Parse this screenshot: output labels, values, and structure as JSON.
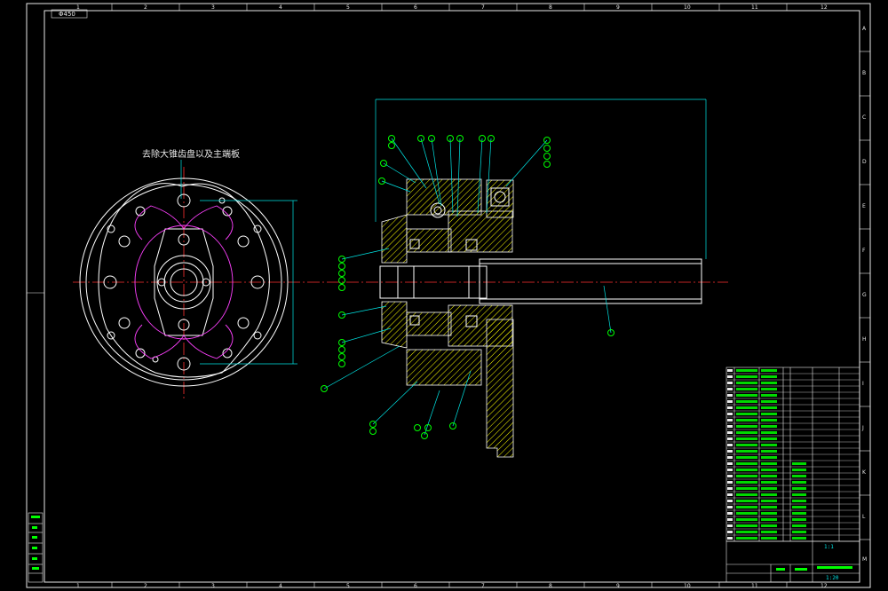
{
  "drawing": {
    "code": "Φ450",
    "annotation": "去除大锥齿盘以及主端板",
    "col_numbers": [
      "1",
      "2",
      "3",
      "4",
      "5",
      "6",
      "7",
      "8",
      "9",
      "10",
      "11",
      "12"
    ],
    "row_letters": [
      "A",
      "B",
      "C",
      "D",
      "E",
      "F",
      "G",
      "H",
      "I",
      "J",
      "K",
      "L",
      "M",
      "N"
    ],
    "colors": {
      "frame": "#e8e8e8",
      "dimension": "#00e6e6",
      "outline": "#ffffff",
      "center_line": "#ff3030",
      "hidden_line": "#ff40ff",
      "section_hatch": "#ffff00",
      "balloon": "#00ff00"
    }
  },
  "title_block": {
    "scale": "1:1",
    "sheet": "1:20"
  }
}
